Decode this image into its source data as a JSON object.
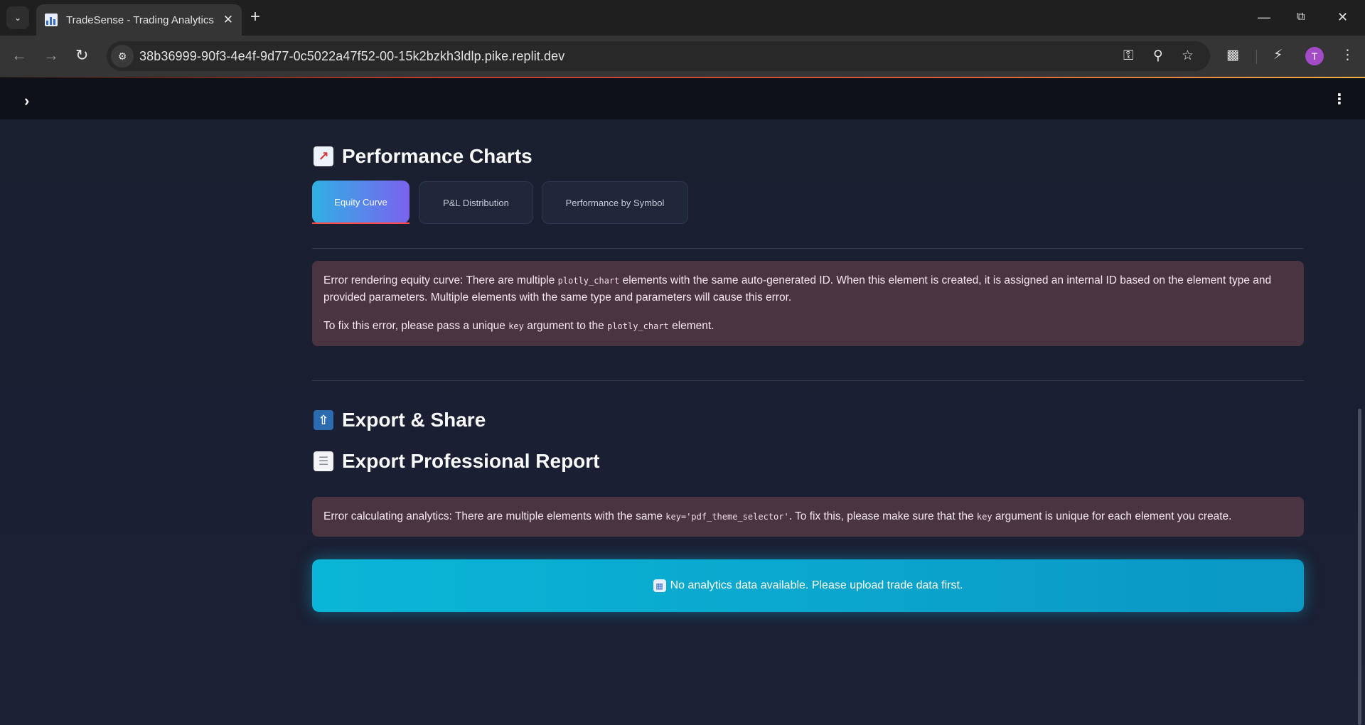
{
  "browser": {
    "tab_title": "TradeSense - Trading Analytics I",
    "url": "38b36999-90f3-4e4f-9d77-0c5022a47f52-00-15k2bzkh3ldlp.pike.replit.dev",
    "avatar_letter": "T"
  },
  "sections": {
    "performance_title": "Performance Charts",
    "export_title": "Export & Share",
    "report_title": "Export Professional Report"
  },
  "tabs": [
    {
      "label": "Equity Curve"
    },
    {
      "label": "P&L Distribution"
    },
    {
      "label": "Performance by Symbol"
    }
  ],
  "errors": {
    "equity": {
      "p1a": "Error rendering equity curve: There are multiple ",
      "p1code": "plotly_chart",
      "p1b": " elements with the same auto-generated ID. When this element is created, it is assigned an internal ID based on the element type and provided parameters. Multiple elements with the same type and parameters will cause this error.",
      "p2a": "To fix this error, please pass a unique ",
      "p2code1": "key",
      "p2b": " argument to the ",
      "p2code2": "plotly_chart",
      "p2c": " element."
    },
    "analytics": {
      "a": "Error calculating analytics: There are multiple elements with the same ",
      "code1": "key='pdf_theme_selector'",
      "b": ". To fix this, please make sure that the ",
      "code2": "key",
      "c": " argument is unique for each element you create."
    }
  },
  "info": {
    "message": "No analytics data available. Please upload trade data first."
  },
  "icons": {
    "chart_emoji": "chart-increasing",
    "outbox_emoji": "outbox-tray",
    "page_emoji": "page-facing-up",
    "bar_chart_emoji": "bar-chart"
  }
}
